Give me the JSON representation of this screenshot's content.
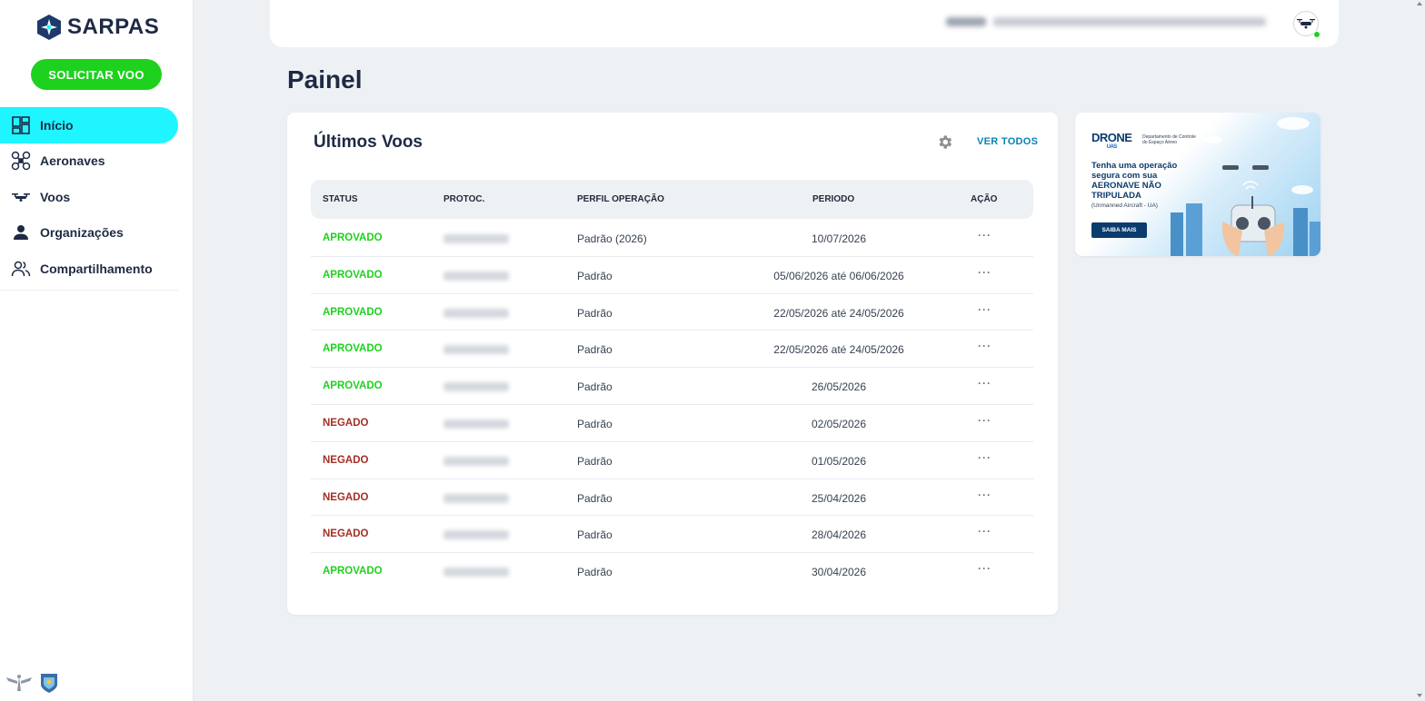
{
  "app": {
    "logo_text": "SARPAS",
    "solicitar_label": "SOLICITAR VOO"
  },
  "sidebar": {
    "items": [
      {
        "label": "Início",
        "icon": "dashboard-icon",
        "active": true
      },
      {
        "label": "Aeronaves",
        "icon": "drone-icon",
        "active": false
      },
      {
        "label": "Voos",
        "icon": "flight-drone-icon",
        "active": false
      },
      {
        "label": "Organizações",
        "icon": "person-icon",
        "active": false
      },
      {
        "label": "Compartilhamento",
        "icon": "people-icon",
        "active": false
      }
    ]
  },
  "page": {
    "title": "Painel"
  },
  "flights_card": {
    "title": "Últimos Voos",
    "ver_todos": "VER TODOS",
    "columns": {
      "status": "STATUS",
      "protocolo": "PROTOC.",
      "perfil": "PERFIL OPERAÇÃO",
      "periodo": "PERIODO",
      "acao": "AÇÃO"
    },
    "rows": [
      {
        "status": "APROVADO",
        "perfil": "Padrão (2026)",
        "periodo": "10/07/2026",
        "acao": "···"
      },
      {
        "status": "APROVADO",
        "perfil": "Padrão",
        "periodo": "05/06/2026 até 06/06/2026",
        "acao": "···"
      },
      {
        "status": "APROVADO",
        "perfil": "Padrão",
        "periodo": "22/05/2026 até 24/05/2026",
        "acao": "···"
      },
      {
        "status": "APROVADO",
        "perfil": "Padrão",
        "periodo": "22/05/2026 até 24/05/2026",
        "acao": "···"
      },
      {
        "status": "APROVADO",
        "perfil": "Padrão",
        "periodo": "26/05/2026",
        "acao": "···"
      },
      {
        "status": "NEGADO",
        "perfil": "Padrão",
        "periodo": "02/05/2026",
        "acao": "···"
      },
      {
        "status": "NEGADO",
        "perfil": "Padrão",
        "periodo": "01/05/2026",
        "acao": "···"
      },
      {
        "status": "NEGADO",
        "perfil": "Padrão",
        "periodo": "25/04/2026",
        "acao": "···"
      },
      {
        "status": "NEGADO",
        "perfil": "Padrão",
        "periodo": "28/04/2026",
        "acao": "···"
      },
      {
        "status": "APROVADO",
        "perfil": "Padrão",
        "periodo": "30/04/2026",
        "acao": "···"
      }
    ]
  },
  "banner": {
    "logo": "DRONE",
    "logo_sub": "UAS",
    "dept": "Departamento de Controle do Espaço Aéreo",
    "text": "Tenha uma operação segura com sua",
    "strong": "AERONAVE NÃO TRIPULADA",
    "sub": "(Unmanned Aircraft - UA)",
    "button": "SAIBA MAIS"
  },
  "colors": {
    "accent_active": "#1ff5ff",
    "primary_button": "#1ed11e",
    "approved": "#1ed11e",
    "denied": "#a33025",
    "link": "#0a82b4"
  }
}
